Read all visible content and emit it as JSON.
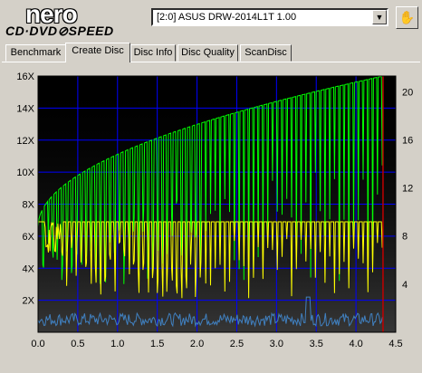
{
  "app": {
    "logo_text": "nero",
    "logo_subtitle": "CD·DVD⊘SPEED"
  },
  "drive": {
    "selected": "[2:0]  ASUS DRW-2014L1T 1.00"
  },
  "tabs": [
    {
      "label": "Benchmark",
      "active": false
    },
    {
      "label": "Create Disc",
      "active": true
    },
    {
      "label": "Disc Info",
      "active": false
    },
    {
      "label": "Disc Quality",
      "active": false
    },
    {
      "label": "ScanDisc",
      "active": false
    }
  ],
  "icons": {
    "eject": "eject-icon",
    "dropdown": "chevron-down-icon"
  },
  "colors": {
    "plot_bg": "#000000",
    "grid": "#0000ff",
    "speed_write": "#ffff00",
    "speed_read": "#00ff00",
    "cpu": "#4080c0",
    "end_marker": "#c00000"
  },
  "chart_data": {
    "type": "line",
    "x_ticks": [
      "0.0",
      "0.5",
      "1.0",
      "1.5",
      "2.0",
      "2.5",
      "3.0",
      "3.5",
      "4.0",
      "4.5"
    ],
    "y_left_ticks": [
      "2X",
      "4X",
      "6X",
      "8X",
      "10X",
      "12X",
      "14X",
      "16X"
    ],
    "y_right_ticks": [
      "4",
      "8",
      "12",
      "16",
      "20"
    ],
    "xlim": [
      0,
      4.5
    ],
    "ylim_left": [
      0,
      16
    ],
    "ylim_right": [
      0,
      21.3
    ],
    "end_marker_x": 4.34,
    "series": [
      {
        "color": "#00ff00",
        "shape": "sqrt-rise",
        "start": 6.6,
        "end": 16.0,
        "dip_spacing": 0.06
      },
      {
        "color": "#ffff00",
        "shape": "flat",
        "level": 6.9,
        "start_dip": [
          0.08,
          0.3
        ],
        "dip_spacing": 0.06
      },
      {
        "color": "#4080c0",
        "shape": "noise",
        "level": 0.4
      }
    ]
  }
}
